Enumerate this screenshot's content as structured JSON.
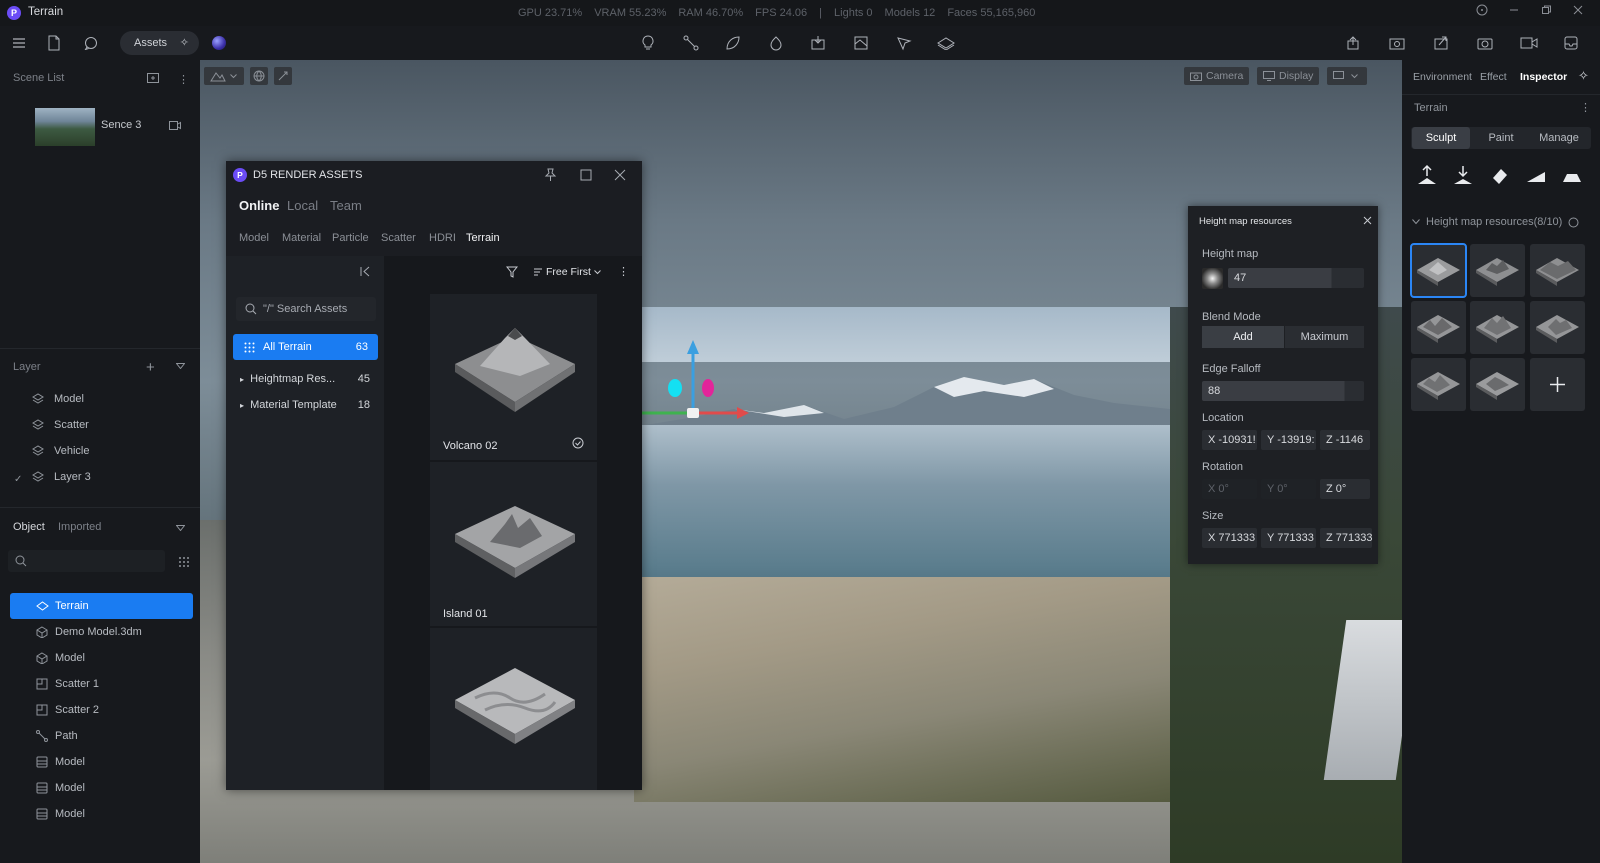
{
  "app": {
    "title": "Terrain",
    "logo_letter": "P"
  },
  "stats": [
    "GPU 23.71%",
    "VRAM 55.23%",
    "RAM 46.70%",
    "FPS 24.06",
    "|",
    "Lights 0",
    "Models 12",
    "Faces 55,165,960"
  ],
  "toolbar": {
    "assets_label": "Assets"
  },
  "left": {
    "scene_list_title": "Scene List",
    "scene_name": "Sence 3",
    "layer_title": "Layer",
    "layers": [
      "Model",
      "Scatter",
      "Vehicle",
      "Layer 3"
    ],
    "object_tab": "Object",
    "imported_tab": "Imported",
    "objects": [
      "Terrain",
      "Demo Model.3dm",
      "Model",
      "Scatter 1",
      "Scatter 2",
      "Path",
      "Model",
      "Model",
      "Model"
    ]
  },
  "viewport": {
    "camera_label": "Camera",
    "display_label": "Display"
  },
  "assets_dialog": {
    "logo_letter": "P",
    "title": "D5 RENDER ASSETS",
    "source_tabs": [
      "Online",
      "Local",
      "Team"
    ],
    "category_tabs": [
      "Model",
      "Material",
      "Particle",
      "Scatter",
      "HDRI",
      "Terrain"
    ],
    "search_placeholder": "\"/\" Search Assets",
    "sort_label": "Free First",
    "all_label": "All Terrain",
    "all_count": "63",
    "tree": [
      {
        "label": "Heightmap Res...",
        "count": "45"
      },
      {
        "label": "Material Template",
        "count": "18"
      }
    ],
    "cards": [
      "Volcano 02",
      "Island 01"
    ]
  },
  "heightmap_popup": {
    "title": "Height map resources",
    "height_map_label": "Height map",
    "height_map_value": "47",
    "blend_mode_label": "Blend Mode",
    "blend_add": "Add",
    "blend_max": "Maximum",
    "edge_falloff_label": "Edge Falloff",
    "edge_falloff_value": "88",
    "location_label": "Location",
    "location": [
      "X -10931!",
      "Y -13919:",
      "Z -1146"
    ],
    "rotation_label": "Rotation",
    "rotation": [
      "X 0°",
      "Y 0°",
      "Z 0°"
    ],
    "size_label": "Size",
    "size": [
      "X 771333",
      "Y 771333",
      "Z 771333"
    ]
  },
  "right": {
    "tabs": [
      "Environment",
      "Effect",
      "Inspector"
    ],
    "section_title": "Terrain",
    "sub_tabs": [
      "Sculpt",
      "Paint",
      "Manage"
    ],
    "resources_title": "Height map resources(8/10)"
  },
  "colors": {
    "accent": "#1a7cf2",
    "brand": "#6b4cf6"
  }
}
